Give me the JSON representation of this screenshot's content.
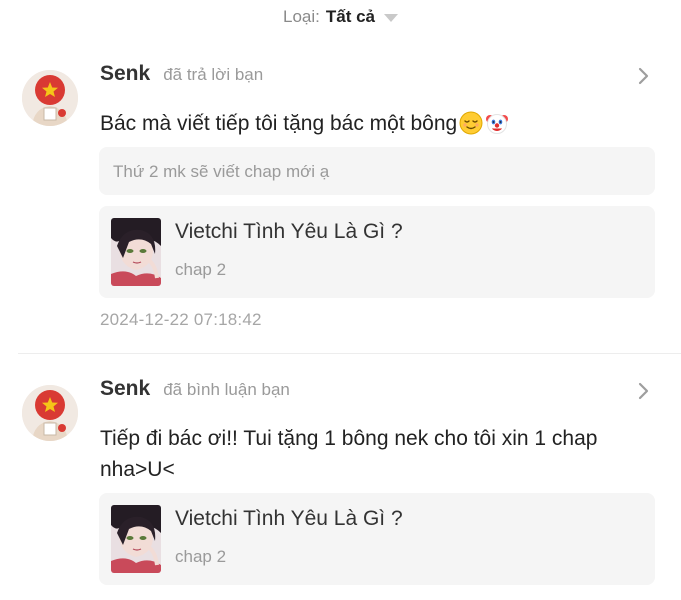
{
  "filter": {
    "label": "Loại:",
    "value": "Tất cả",
    "icon": "caret-down-icon"
  },
  "notifications": [
    {
      "username": "Senk",
      "action": "đã trả lời bạn",
      "message": "Bác mà viết tiếp tôi tặng bác một bông",
      "emojis": [
        "relieved-face-emoji",
        "clown-face-emoji"
      ],
      "quoted_comment": "Thứ 2 mk sẽ viết chap mới ạ",
      "story": {
        "title": "Vietchi Tình Yêu Là Gì ?",
        "chapter": "chap 2"
      },
      "timestamp": "2024-12-22 07:18:42"
    },
    {
      "username": "Senk",
      "action": "đã bình luận bạn",
      "message": "Tiếp đi bác ơi!! Tui tặng 1 bông nek cho tôi xin 1 chap nha>U<",
      "story": {
        "title": "Vietchi Tình Yêu Là Gì ?",
        "chapter": "chap 2"
      }
    }
  ],
  "colors": {
    "background": "#ffffff",
    "card_background": "#f5f5f5",
    "muted_text": "#9a9a9a",
    "primary_text": "#222222",
    "avatar_red": "#d93a33",
    "avatar_star": "#f5c518"
  }
}
